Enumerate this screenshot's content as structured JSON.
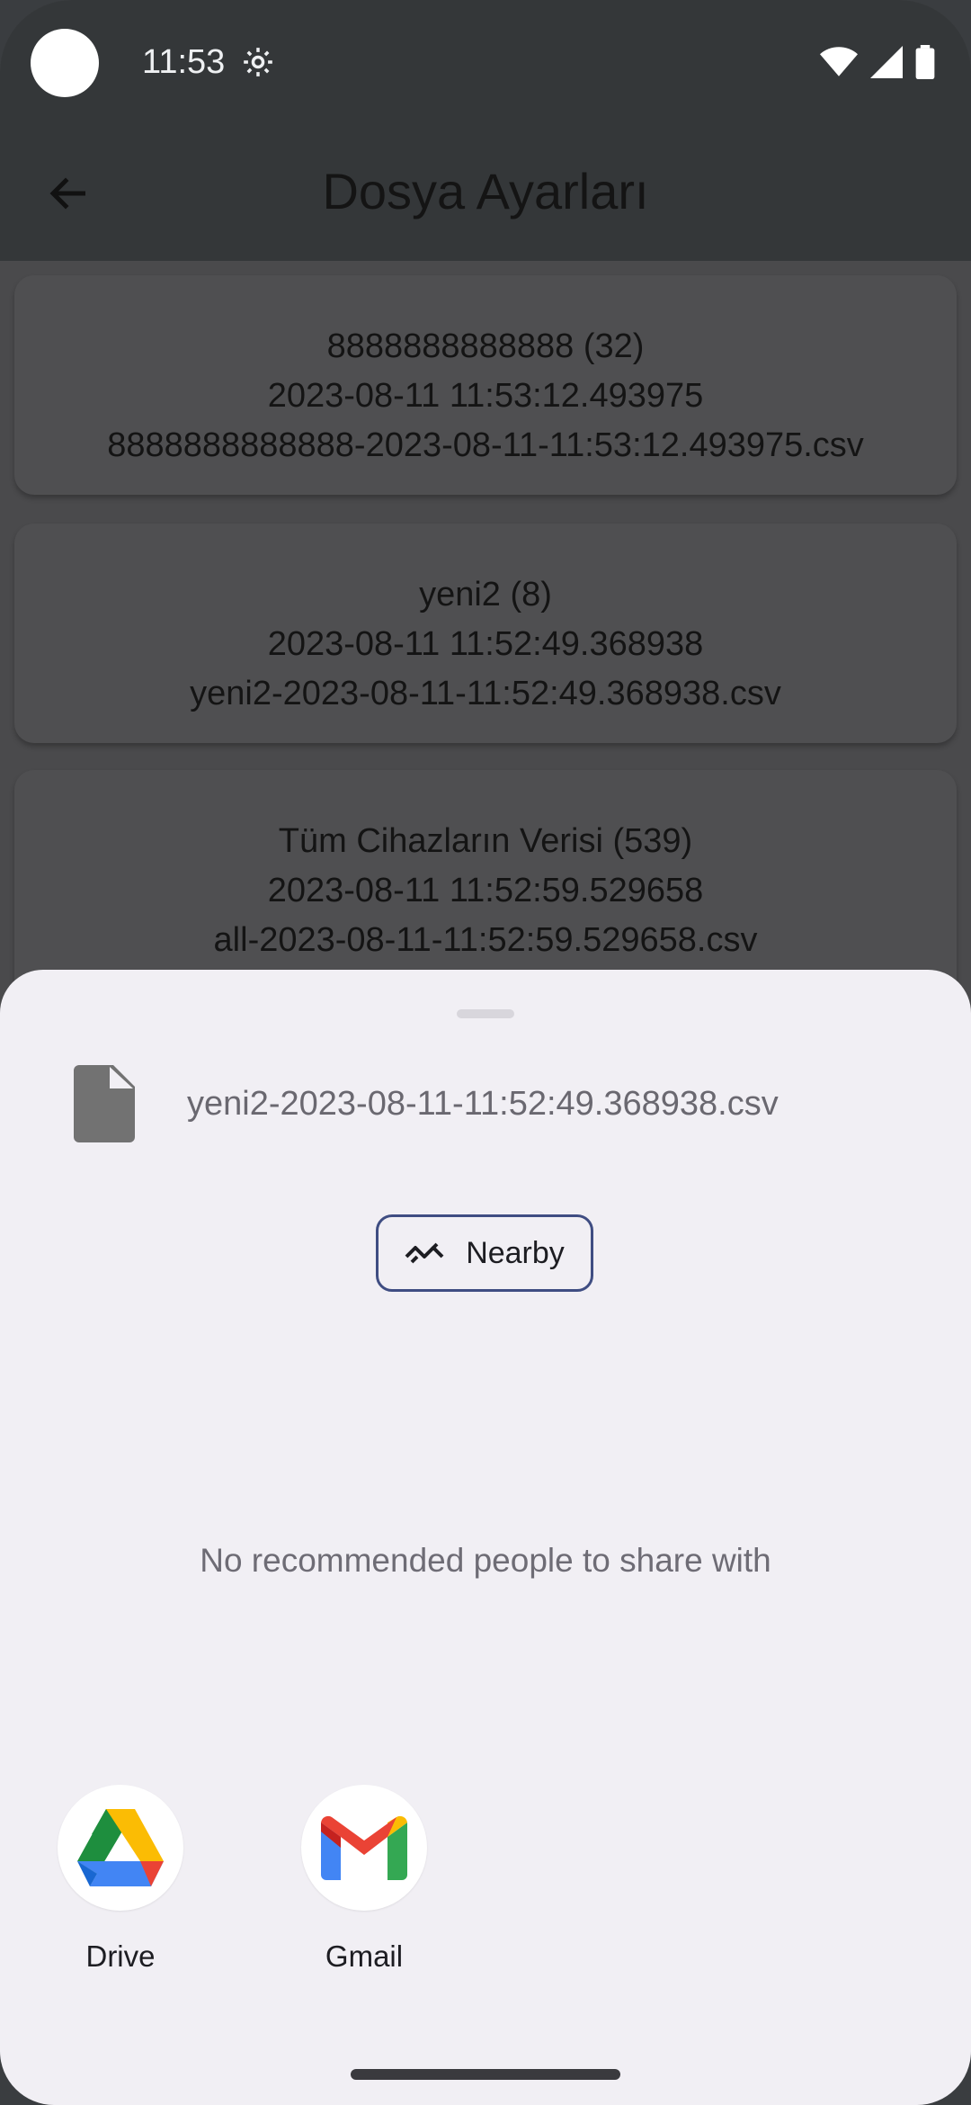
{
  "status": {
    "time": "11:53"
  },
  "appbar": {
    "title": "Dosya Ayarları"
  },
  "files": [
    {
      "name": "8888888888888 (32)",
      "date": "2023-08-11 11:53:12.493975",
      "file": "8888888888888-2023-08-11-11:53:12.493975.csv"
    },
    {
      "name": "yeni2 (8)",
      "date": "2023-08-11 11:52:49.368938",
      "file": "yeni2-2023-08-11-11:52:49.368938.csv"
    },
    {
      "name": "Tüm Cihazların Verisi (539)",
      "date": "2023-08-11 11:52:59.529658",
      "file": "all-2023-08-11-11:52:59.529658.csv"
    }
  ],
  "share": {
    "file_name": "yeni2-2023-08-11-11:52:49.368938.csv",
    "nearby_label": "Nearby",
    "no_recommendation": "No recommended people to share with",
    "apps": [
      {
        "label": "Drive",
        "icon": "google-drive-icon"
      },
      {
        "label": "Gmail",
        "icon": "gmail-icon"
      }
    ]
  },
  "colors": {
    "accent_outline": "#3f4d82",
    "sheet_bg": "#f1eff4",
    "scrim_bar": "#343739"
  }
}
